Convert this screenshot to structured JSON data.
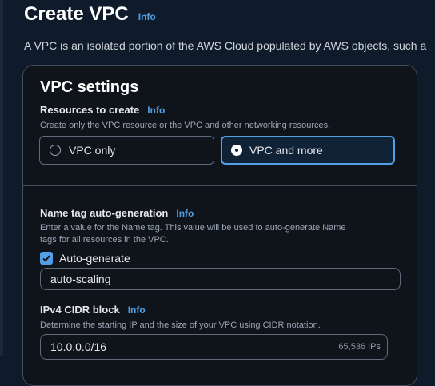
{
  "page": {
    "title": "Create VPC",
    "title_info": "Info",
    "description": "A VPC is an isolated portion of the AWS Cloud populated by AWS objects, such a"
  },
  "vpc_settings": {
    "heading": "VPC settings",
    "resources": {
      "label": "Resources to create",
      "info": "Info",
      "help": "Create only the VPC resource or the VPC and other networking resources.",
      "options": [
        "VPC only",
        "VPC and more"
      ],
      "selected": "VPC and more"
    },
    "name_tag": {
      "label": "Name tag auto-generation",
      "info": "Info",
      "help_line1": "Enter a value for the Name tag. This value will be used to auto-generate Name",
      "help_line2": "tags for all resources in the VPC.",
      "checkbox_label": "Auto-generate",
      "checked": true,
      "value": "auto-scaling"
    },
    "ipv4": {
      "label": "IPv4 CIDR block",
      "info": "Info",
      "help": "Determine the starting IP and the size of your VPC using CIDR notation.",
      "value": "10.0.0.0/16",
      "ip_count": "65,536 IPs"
    }
  },
  "colors": {
    "accent": "#539fe5",
    "background": "#0f1b2a",
    "panel": "#0f141a"
  }
}
